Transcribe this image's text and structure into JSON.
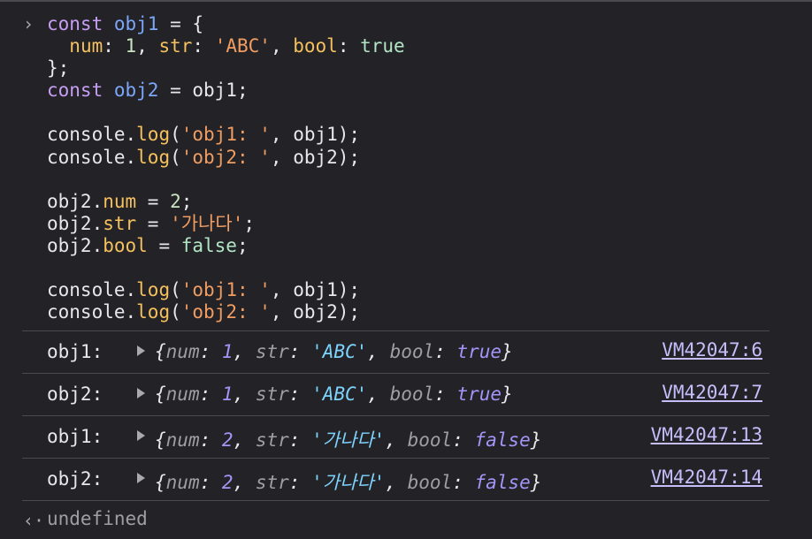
{
  "console": {
    "prompt_glyph": "›",
    "code_lines": [
      [
        {
          "t": "kw",
          "v": "const"
        },
        {
          "t": "plain",
          "v": " "
        },
        {
          "t": "var",
          "v": "obj1"
        },
        {
          "t": "plain",
          "v": " = {"
        }
      ],
      [
        {
          "t": "plain",
          "v": "  "
        },
        {
          "t": "prop",
          "v": "num"
        },
        {
          "t": "plain",
          "v": ": "
        },
        {
          "t": "num",
          "v": "1"
        },
        {
          "t": "plain",
          "v": ", "
        },
        {
          "t": "prop",
          "v": "str"
        },
        {
          "t": "plain",
          "v": ": "
        },
        {
          "t": "str",
          "v": "'ABC'"
        },
        {
          "t": "plain",
          "v": ", "
        },
        {
          "t": "prop",
          "v": "bool"
        },
        {
          "t": "plain",
          "v": ": "
        },
        {
          "t": "bool",
          "v": "true"
        }
      ],
      [
        {
          "t": "plain",
          "v": "};"
        }
      ],
      [
        {
          "t": "kw",
          "v": "const"
        },
        {
          "t": "plain",
          "v": " "
        },
        {
          "t": "var",
          "v": "obj2"
        },
        {
          "t": "plain",
          "v": " = obj1;"
        }
      ],
      [],
      [
        {
          "t": "plain",
          "v": "console."
        },
        {
          "t": "fn",
          "v": "log"
        },
        {
          "t": "plain",
          "v": "("
        },
        {
          "t": "str",
          "v": "'obj1: '"
        },
        {
          "t": "plain",
          "v": ", obj1);"
        }
      ],
      [
        {
          "t": "plain",
          "v": "console."
        },
        {
          "t": "fn",
          "v": "log"
        },
        {
          "t": "plain",
          "v": "("
        },
        {
          "t": "str",
          "v": "'obj2: '"
        },
        {
          "t": "plain",
          "v": ", obj2);"
        }
      ],
      [],
      [
        {
          "t": "plain",
          "v": "obj2."
        },
        {
          "t": "prop",
          "v": "num"
        },
        {
          "t": "plain",
          "v": " = "
        },
        {
          "t": "num",
          "v": "2"
        },
        {
          "t": "plain",
          "v": ";"
        }
      ],
      [
        {
          "t": "plain",
          "v": "obj2."
        },
        {
          "t": "prop",
          "v": "str"
        },
        {
          "t": "plain",
          "v": " = "
        },
        {
          "t": "str",
          "v": "'가나다'"
        },
        {
          "t": "plain",
          "v": ";"
        }
      ],
      [
        {
          "t": "plain",
          "v": "obj2."
        },
        {
          "t": "prop",
          "v": "bool"
        },
        {
          "t": "plain",
          "v": " = "
        },
        {
          "t": "bool",
          "v": "false"
        },
        {
          "t": "plain",
          "v": ";"
        }
      ],
      [],
      [
        {
          "t": "plain",
          "v": "console."
        },
        {
          "t": "fn",
          "v": "log"
        },
        {
          "t": "plain",
          "v": "("
        },
        {
          "t": "str",
          "v": "'obj1: '"
        },
        {
          "t": "plain",
          "v": ", obj1);"
        }
      ],
      [
        {
          "t": "plain",
          "v": "console."
        },
        {
          "t": "fn",
          "v": "log"
        },
        {
          "t": "plain",
          "v": "("
        },
        {
          "t": "str",
          "v": "'obj2: '"
        },
        {
          "t": "plain",
          "v": ", obj2);"
        }
      ]
    ],
    "logs": [
      {
        "label": "obj1:",
        "num": "1",
        "str": "'ABC'",
        "bool": "true",
        "source": "VM42047:6"
      },
      {
        "label": "obj2:",
        "num": "1",
        "str": "'ABC'",
        "bool": "true",
        "source": "VM42047:7"
      },
      {
        "label": "obj1:",
        "num": "2",
        "str": "'가나다'",
        "bool": "false",
        "source": "VM42047:13"
      },
      {
        "label": "obj2:",
        "num": "2",
        "str": "'가나다'",
        "bool": "false",
        "source": "VM42047:14"
      }
    ],
    "result_glyph": "‹·",
    "result_text": "undefined"
  }
}
